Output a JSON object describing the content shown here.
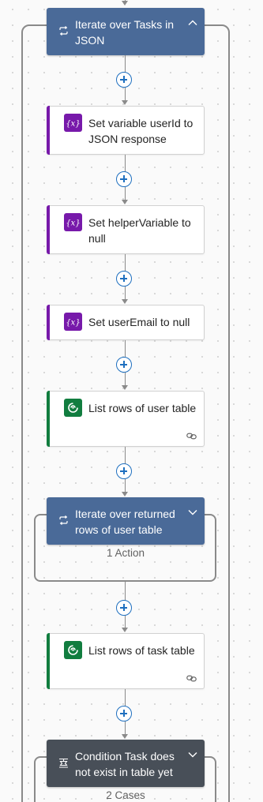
{
  "colors": {
    "loop_header": "#4a6a98",
    "condition_header": "#484f58",
    "variable_icon": "#7719aa",
    "dataverse_icon": "#117d3f",
    "connector": "#8a8a8a",
    "add_button": "#1e6fbf"
  },
  "flow": {
    "outer_loop": {
      "title": "Iterate over Tasks in JSON",
      "icon": "loop-icon",
      "chevron": "chevron-up-icon"
    },
    "actions": [
      {
        "title": "Set variable userId to JSON response",
        "icon": "variable-icon"
      },
      {
        "title": "Set helperVariable to null",
        "icon": "variable-icon"
      },
      {
        "title": "Set userEmail to null",
        "icon": "variable-icon"
      },
      {
        "title": "List rows of user table",
        "icon": "dataverse-icon",
        "footer_icon": "link-icon"
      }
    ],
    "inner_loop": {
      "title": "Iterate over returned rows of user table",
      "icon": "loop-icon",
      "chevron": "chevron-down-icon",
      "footer": "1 Action"
    },
    "task_list": {
      "title": "List rows of task table",
      "icon": "dataverse-icon",
      "footer_icon": "link-icon"
    },
    "condition": {
      "title": "Condition Task does not exist in table yet",
      "icon": "condition-icon",
      "chevron": "chevron-down-icon",
      "footer": "2 Cases"
    }
  }
}
